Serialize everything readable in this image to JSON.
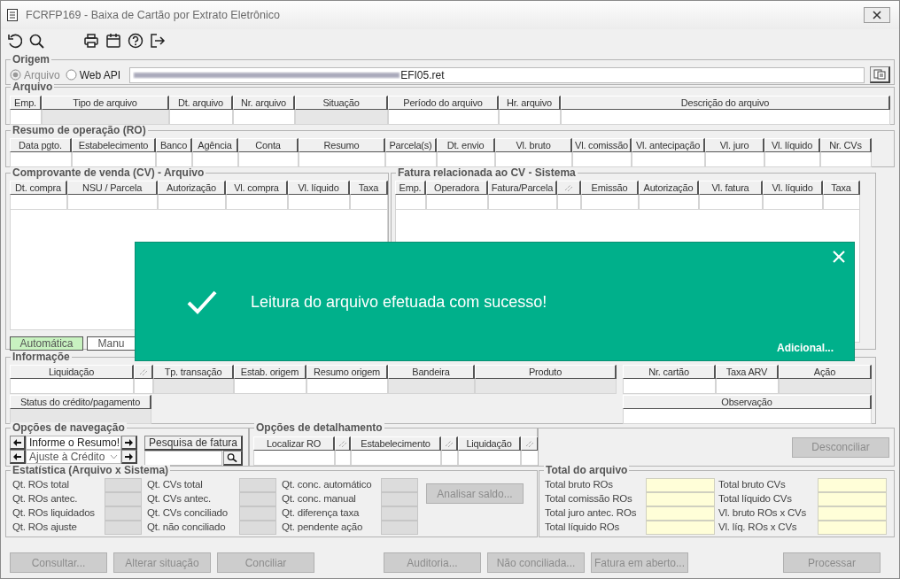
{
  "window": {
    "title": "FCRFP169 - Baixa de Cartão por Extrato Eletrônico"
  },
  "origem": {
    "title": "Origem",
    "options": [
      {
        "label": "Arquivo",
        "selected": true,
        "disabled": true
      },
      {
        "label": "Web API",
        "selected": false,
        "disabled": false
      }
    ],
    "file": "EFI05.ret"
  },
  "arquivo": {
    "title": "Arquivo",
    "columns": [
      {
        "label": "Emp.",
        "readonly": false
      },
      {
        "label": "Tipo de arquivo",
        "readonly": true
      },
      {
        "label": "Dt. arquivo",
        "readonly": false
      },
      {
        "label": "Nr. arquivo",
        "readonly": false
      },
      {
        "label": "Situação",
        "readonly": true
      },
      {
        "label": "Período do arquivo",
        "readonly": false
      },
      {
        "label": "Hr. arquivo",
        "readonly": false
      },
      {
        "label": "Descrição do arquivo",
        "readonly": false
      }
    ]
  },
  "resumo_operacao": {
    "title": "Resumo de operação (RO)",
    "columns": [
      {
        "label": "Data pgto.",
        "readonly": false
      },
      {
        "label": "Estabelecimento",
        "readonly": false
      },
      {
        "label": "Banco",
        "readonly": false
      },
      {
        "label": "Agência",
        "readonly": false
      },
      {
        "label": "Conta",
        "readonly": false
      },
      {
        "label": "Resumo",
        "readonly": false
      },
      {
        "label": "Parcela(s)",
        "readonly": false
      },
      {
        "label": "Dt. envio",
        "readonly": false
      },
      {
        "label": "Vl. bruto",
        "readonly": false
      },
      {
        "label": "Vl. comissão",
        "readonly": false
      },
      {
        "label": "Vl. antecipação",
        "readonly": false
      },
      {
        "label": "Vl. juro",
        "readonly": false
      },
      {
        "label": "Vl. líquido",
        "readonly": false
      },
      {
        "label": "Nr. CVs",
        "readonly": false
      }
    ]
  },
  "comprovante_venda": {
    "title": "Comprovante de venda (CV) - Arquivo",
    "columns": [
      {
        "label": "Dt. compra",
        "readonly": false
      },
      {
        "label": "NSU / Parcela",
        "readonly": false
      },
      {
        "label": "Autorização",
        "readonly": false
      },
      {
        "label": "Vl. compra",
        "readonly": false
      },
      {
        "label": "Vl. líquido",
        "readonly": false
      },
      {
        "label": "Taxa",
        "readonly": false
      }
    ],
    "modes": [
      {
        "label": "Automática",
        "selected": true
      },
      {
        "label": "Manu",
        "selected": false
      }
    ]
  },
  "fatura": {
    "title": "Fatura relacionada ao CV - Sistema",
    "columns": [
      {
        "kind": "text",
        "label": "Emp.",
        "readonly": false
      },
      {
        "kind": "text",
        "label": "Operadora",
        "readonly": false
      },
      {
        "kind": "text",
        "label": "Fatura/Parcela",
        "readonly": false
      },
      {
        "kind": "sort",
        "readonly": false
      },
      {
        "kind": "text",
        "label": "Emissão",
        "readonly": false
      },
      {
        "kind": "text",
        "label": "Autorização",
        "readonly": false
      },
      {
        "kind": "text",
        "label": "Vl. fatura",
        "readonly": false
      },
      {
        "kind": "text",
        "label": "Vl. líquido",
        "readonly": false
      },
      {
        "kind": "text",
        "label": "Taxa",
        "readonly": false
      }
    ]
  },
  "informacoes": {
    "title": "Informaçõe",
    "columns": [
      {
        "kind": "text",
        "label": "Liquidação",
        "readonly": false
      },
      {
        "kind": "sort",
        "readonly": false
      },
      {
        "kind": "text",
        "label": "Tp. transação",
        "readonly": true
      },
      {
        "kind": "text",
        "label": "Estab. origem",
        "readonly": false
      },
      {
        "kind": "text",
        "label": "Resumo origem",
        "readonly": false
      },
      {
        "kind": "text",
        "label": "Bandeira",
        "readonly": true
      },
      {
        "kind": "text",
        "label": "Produto",
        "readonly": true
      }
    ],
    "side_columns": [
      {
        "label": "Nr. cartão",
        "readonly": false
      },
      {
        "label": "Taxa ARV",
        "readonly": false
      },
      {
        "label": "Ação",
        "readonly": true
      }
    ],
    "status": {
      "label": "Status do crédito/pagamento",
      "readonly": true
    },
    "observacao": {
      "label": "Observação",
      "readonly": false
    }
  },
  "navegacao": {
    "title": "Opções de navegação",
    "fields": [
      {
        "kind": "text",
        "value": "Informe o Resumo!"
      },
      {
        "kind": "dropdown",
        "value": "Ajuste à Crédito"
      }
    ],
    "search_button": "Pesquisa de fatura"
  },
  "detalhamento": {
    "title": "Opções de detalhamento",
    "columns": [
      {
        "kind": "text",
        "label": "Localizar RO",
        "readonly": false
      },
      {
        "kind": "sort",
        "readonly": false
      },
      {
        "kind": "text",
        "label": "Estabelecimento",
        "readonly": false
      },
      {
        "kind": "sort",
        "readonly": false
      },
      {
        "kind": "text",
        "label": "Liquidação",
        "readonly": false
      },
      {
        "kind": "sort",
        "readonly": false
      }
    ]
  },
  "desconciliar": {
    "label": "Desconciliar",
    "disabled": true
  },
  "estatistica": {
    "title": "Estatística (Arquivo x Sistema)",
    "columns": [
      [
        "Qt. ROs total",
        "Qt. ROs antec.",
        "Qt. ROs liquidados",
        "Qt. ROs ajuste"
      ],
      [
        "Qt. CVs total",
        "Qt. CVs antec.",
        "Qt. CVs conciliado",
        "Qt. não conciliado"
      ],
      [
        "Qt. conc. automático",
        "Qt. conc. manual",
        "Qt. diferença taxa",
        "Qt. pendente ação"
      ]
    ],
    "analyze_button": {
      "label": "Analisar saldo...",
      "disabled": true
    }
  },
  "total": {
    "title": "Total do arquivo",
    "columns": [
      [
        "Total bruto ROs",
        "Total comissão ROs",
        "Total juro antec. ROs",
        "Total líquido ROs"
      ],
      [
        "Total bruto CVs",
        "Total líquido CVs",
        "Vl. bruto ROs x CVs",
        "Vl. líq. ROs x CVs"
      ]
    ]
  },
  "actions": [
    {
      "label": "Consultar...",
      "disabled": true
    },
    {
      "label": "Alterar situação",
      "disabled": true
    },
    {
      "label": "Conciliar",
      "disabled": true
    },
    {
      "label": "Auditoria...",
      "disabled": true
    },
    {
      "label": "Não conciliada...",
      "disabled": true
    },
    {
      "label": "Fatura em aberto...",
      "disabled": true
    },
    {
      "label": "Processar",
      "disabled": true
    }
  ],
  "toast": {
    "message": "Leitura do arquivo efetuada com sucesso!",
    "link": "Adicional..."
  }
}
